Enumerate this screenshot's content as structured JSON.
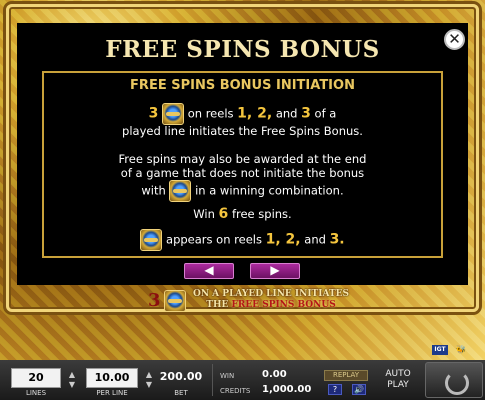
{
  "panel": {
    "title": "FREE SPINS BONUS",
    "subtitle": "FREE SPINS BONUS INITIATION",
    "line1_num": "3",
    "line1_text": "on reels",
    "line1_reels": "1, 2,",
    "line1_and": "and",
    "line1_3": "3",
    "line1_end": "of a",
    "line2": "played line initiates the Free Spins Bonus.",
    "line3": "Free spins may also be awarded at the end",
    "line4": "of a game that does not initiate the bonus",
    "line5_with": "with",
    "line5_end": "in a winning combination.",
    "line6_win": "Win",
    "line6_num": "6",
    "line6_end": "free spins.",
    "line7_text": "appears on reels",
    "line7_reels": "1, 2,",
    "line7_and": "and",
    "line7_3": "3."
  },
  "nav": {
    "prev": "◀",
    "next": "▶",
    "close": "✕"
  },
  "banner": {
    "num": "3",
    "line1": "ON A PLAYED LINE INITIATES",
    "line2_the": "THE",
    "line2_bonus": "FREE SPINS BONUS"
  },
  "logos": {
    "igt": "IGT",
    "other": "🐝"
  },
  "controls": {
    "lines_value": "20",
    "lines_label": "LINES",
    "per_line_value": "10.00",
    "per_line_label": "PER LINE",
    "bet_value": "200.00",
    "bet_label": "BET",
    "win_label": "WIN",
    "win_value": "0.00",
    "credits_label": "CREDITS",
    "credits_value": "1,000.00",
    "replay": "REPLAY",
    "help": "?",
    "sound": "🔊",
    "autoplay_1": "AUTO",
    "autoplay_2": "PLAY"
  }
}
